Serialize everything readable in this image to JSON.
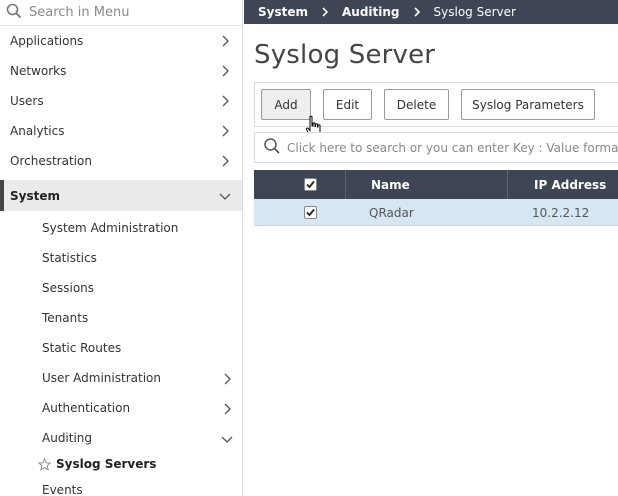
{
  "sidebar": {
    "search_placeholder": "Search in Menu",
    "items": [
      {
        "label": "Applications"
      },
      {
        "label": "Networks"
      },
      {
        "label": "Users"
      },
      {
        "label": "Analytics"
      },
      {
        "label": "Orchestration"
      },
      {
        "label": "System"
      }
    ],
    "system_children": [
      {
        "label": "System Administration"
      },
      {
        "label": "Statistics"
      },
      {
        "label": "Sessions"
      },
      {
        "label": "Tenants"
      },
      {
        "label": "Static Routes"
      },
      {
        "label": "User Administration"
      },
      {
        "label": "Authentication"
      },
      {
        "label": "Auditing"
      }
    ],
    "auditing_children": [
      {
        "label": "Syslog Servers"
      }
    ],
    "next_item": "Events"
  },
  "breadcrumb": [
    "System",
    "Auditing",
    "Syslog Server"
  ],
  "main": {
    "title": "Syslog Server",
    "buttons": {
      "add": "Add",
      "edit": "Edit",
      "delete": "Delete",
      "syslog_parameters": "Syslog Parameters"
    },
    "search_placeholder": "Click here to search or you can enter Key : Value format"
  },
  "table": {
    "columns": [
      "Name",
      "IP Address"
    ],
    "rows": [
      {
        "name": "QRadar",
        "ip": "10.2.2.12",
        "checked": true
      }
    ]
  },
  "colors": {
    "header_bg": "#3e4656",
    "selected_row_bg": "#d6e6f2",
    "active_nav_bg": "#ebebeb"
  }
}
